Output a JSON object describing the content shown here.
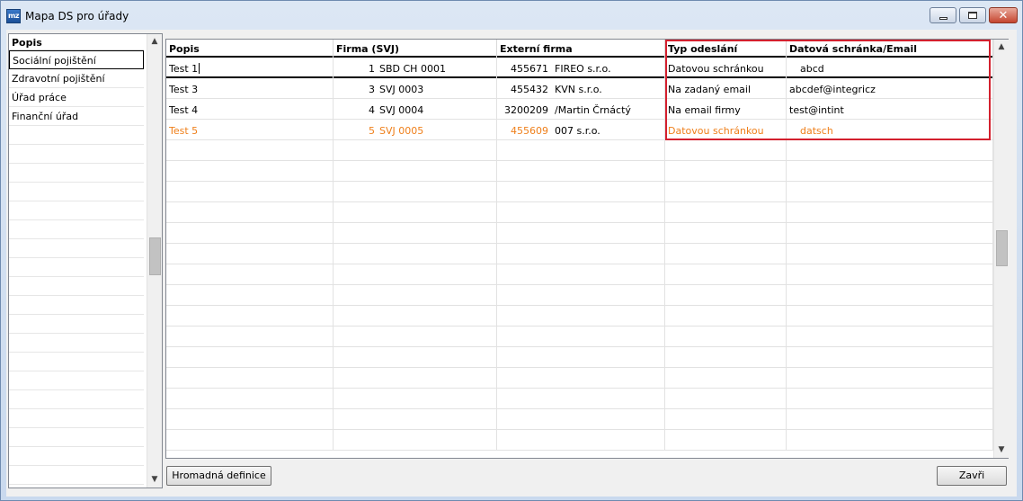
{
  "window": {
    "title": "Mapa DS pro úřady",
    "icon_text": "mz"
  },
  "left": {
    "header": "Popis",
    "items": [
      "Sociální pojištění",
      "Zdravotní pojištění",
      "Úřad práce",
      "Finanční úřad"
    ],
    "selected_index": 0
  },
  "grid": {
    "columns": [
      "Popis",
      "Firma (SVJ)",
      "Externí firma",
      "Typ odeslání",
      "Datová schránka/Email"
    ],
    "rows": [
      {
        "popis": "Test 1",
        "firma_num": "1",
        "firma_name": "SBD CH 0001",
        "ext_num": "455671",
        "ext_name": "FIREO  s.r.o.",
        "typ": "Datovou schránkou",
        "email": "abcd",
        "orange": false
      },
      {
        "popis": "Test 3",
        "firma_num": "3",
        "firma_name": "SVJ 0003",
        "ext_num": "455432",
        "ext_name": "KVN s.r.o.",
        "typ": "Na zadaný email",
        "email": "abcdef@integricz",
        "orange": false
      },
      {
        "popis": "Test 4",
        "firma_num": "4",
        "firma_name": "SVJ 0004",
        "ext_num": "3200209",
        "ext_name": "/Martin Črnáctý",
        "typ": "Na email firmy",
        "email": "test@intint",
        "orange": false
      },
      {
        "popis": "Test 5",
        "firma_num": "5",
        "firma_name": "SVJ 0005",
        "ext_num": "455609",
        "ext_name": "007 s.r.o.",
        "typ": "Datovou schránkou",
        "email": "datsch",
        "orange": true
      }
    ],
    "orange_color": "#ef7f1a",
    "highlight_color": "#d3202e"
  },
  "buttons": {
    "bulk": "Hromadná definice",
    "close": "Zavři"
  }
}
